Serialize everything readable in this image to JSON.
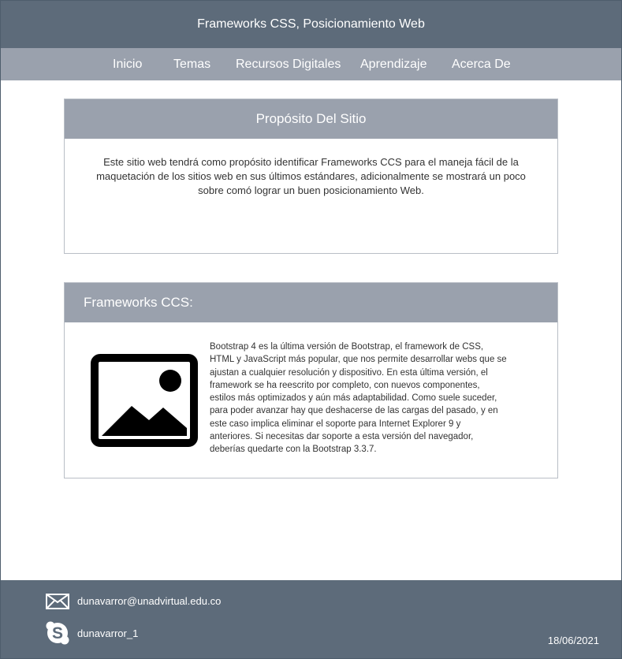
{
  "header": {
    "title": "Frameworks CSS, Posicionamiento Web"
  },
  "nav": {
    "items": [
      {
        "label": "Inicio"
      },
      {
        "label": "Temas"
      },
      {
        "label": "Recursos Digitales"
      },
      {
        "label": "Aprendizaje"
      },
      {
        "label": "Acerca De"
      }
    ]
  },
  "purpose": {
    "heading": "Propósito Del Sitio",
    "lines": [
      "Este sitio web tendrá como propósito identificar Frameworks CCS para el maneja fácil de la",
      "maquetación de los sitios web en sus últimos estándares,  adicionalmente se mostrará un poco",
      "sobre comó lograr un buen posicionamiento Web."
    ]
  },
  "frameworks": {
    "heading": "Frameworks CCS:",
    "image_icon": "image-placeholder-icon",
    "lines": [
      "Bootstrap 4 es la última versión de Bootstrap, el framework de CSS,",
      "HTML  y JavaScript más popular, que nos permite desarrollar webs que se",
      "ajustan a cualquier resolución y dispositivo. En esta última versión, el",
      "framework se ha reescrito por completo, con nuevos componentes,",
      "estilos más optimizados y aún más adaptabilidad. Como suele suceder,",
      "para poder avanzar hay que deshacerse de las cargas del pasado, y en",
      "este caso implica eliminar el soporte para Internet Explorer 9 y",
      "anteriores. Si necesitas dar soporte a esta versión del navegador,",
      "deberías quedarte con la Bootstrap 3.3.7."
    ]
  },
  "footer": {
    "email_icon": "mail-icon",
    "email": "dunavarror@unadvirtual.edu.co",
    "skype_icon": "skype-icon",
    "skype": "dunavarror_1",
    "date": "18/06/2021"
  },
  "colors": {
    "header_bg": "#5d6b7a",
    "nav_bg": "#9aa1ad",
    "card_head_bg": "#9aa1ad",
    "footer_bg": "#5d6b7a"
  }
}
